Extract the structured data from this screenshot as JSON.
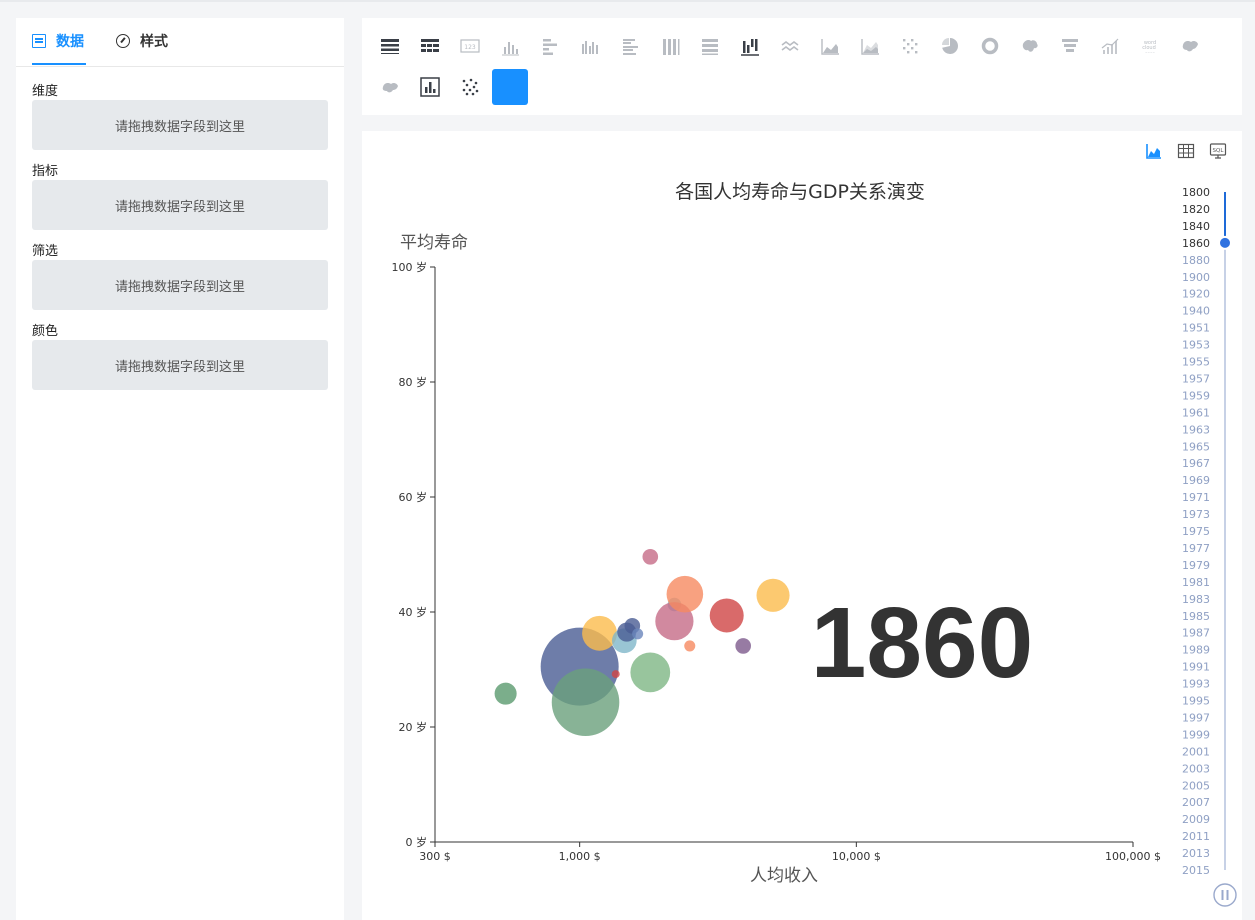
{
  "left_panel": {
    "tabs": {
      "data": "数据",
      "style": "样式"
    },
    "sections": [
      {
        "label": "维度",
        "placeholder": "请拖拽数据字段到这里"
      },
      {
        "label": "指标",
        "placeholder": "请拖拽数据字段到这里"
      },
      {
        "label": "筛选",
        "placeholder": "请拖拽数据字段到这里"
      },
      {
        "label": "颜色",
        "placeholder": "请拖拽数据字段到这里"
      }
    ]
  },
  "toolbar": {
    "chart_types": [
      "table-icon",
      "pivot-table-icon",
      "kpi-number-icon",
      "column-chart-icon",
      "bar-chart-icon",
      "grouped-column-icon",
      "grouped-bar-icon",
      "stacked-column-icon",
      "stacked-bar-icon",
      "waterfall-icon",
      "line-chart-icon",
      "area-chart-icon",
      "stacked-area-icon",
      "heatmap-icon",
      "pie-chart-icon",
      "donut-chart-icon",
      "world-map-icon",
      "funnel-chart-icon",
      "combo-chart-icon",
      "word-cloud-icon",
      "china-map-icon",
      "flow-map-icon",
      "histogram-icon",
      "scatter-plot-icon",
      "bubble-animation-icon"
    ],
    "word_cloud_text": "word cloud",
    "selected": "bubble-animation-icon",
    "accent_color": "#1890ff",
    "inactive_color": "#b8bcc2"
  },
  "chart_header": {
    "views": [
      "chart-view-icon",
      "table-view-icon",
      "sql-view-icon"
    ],
    "sql_text": "SQL"
  },
  "chart_data": {
    "type": "scatter",
    "title": "各国人均寿命与GDP关系演变",
    "xlabel": "人均收入",
    "ylabel": "平均寿命",
    "x_scale": "log",
    "xlim": [
      300,
      100000
    ],
    "ylim": [
      0,
      100
    ],
    "x_ticks": [
      "300 $",
      "1,000 $",
      "10,000 $",
      "100,000 $"
    ],
    "x_tick_values": [
      300,
      1000,
      10000,
      100000
    ],
    "y_ticks": [
      "0 岁",
      "20 岁",
      "40 岁",
      "60 岁",
      "80 岁",
      "100 岁"
    ],
    "y_tick_values": [
      0,
      20,
      40,
      60,
      80,
      100
    ],
    "current_year": "1860",
    "grid": false,
    "points": [
      {
        "x": 540,
        "y": 25.8,
        "size": 0.08,
        "color": "#5a9a6e"
      },
      {
        "x": 1000,
        "y": 30.5,
        "size": 1.0,
        "color": "#4a5d94"
      },
      {
        "x": 1050,
        "y": 24.3,
        "size": 0.75,
        "color": "#6aa07c"
      },
      {
        "x": 1180,
        "y": 36.3,
        "size": 0.2,
        "color": "#fbbc4c"
      },
      {
        "x": 1350,
        "y": 29.2,
        "size": 0.01,
        "color": "#d04545"
      },
      {
        "x": 1450,
        "y": 35.0,
        "size": 0.1,
        "color": "#7fb6c9"
      },
      {
        "x": 1480,
        "y": 36.5,
        "size": 0.06,
        "color": "#4a5d94"
      },
      {
        "x": 1550,
        "y": 37.6,
        "size": 0.04,
        "color": "#4a5d94"
      },
      {
        "x": 1620,
        "y": 36.2,
        "size": 0.02,
        "color": "#6a86bb"
      },
      {
        "x": 1800,
        "y": 29.5,
        "size": 0.26,
        "color": "#7eb785"
      },
      {
        "x": 1800,
        "y": 49.6,
        "size": 0.04,
        "color": "#c56b87"
      },
      {
        "x": 2200,
        "y": 41.3,
        "size": 0.03,
        "color": "#7fb6c9"
      },
      {
        "x": 2200,
        "y": 38.4,
        "size": 0.24,
        "color": "#c56b87"
      },
      {
        "x": 2500,
        "y": 34.1,
        "size": 0.02,
        "color": "#f68960"
      },
      {
        "x": 2400,
        "y": 43.1,
        "size": 0.22,
        "color": "#f68960"
      },
      {
        "x": 3400,
        "y": 39.4,
        "size": 0.19,
        "color": "#d04545"
      },
      {
        "x": 3900,
        "y": 34.1,
        "size": 0.04,
        "color": "#7d5a8c"
      },
      {
        "x": 5000,
        "y": 42.9,
        "size": 0.18,
        "color": "#fbbc4c"
      }
    ]
  },
  "timeline": {
    "years": [
      "1800",
      "1820",
      "1840",
      "1860",
      "1880",
      "1900",
      "1920",
      "1940",
      "1951",
      "1953",
      "1955",
      "1957",
      "1959",
      "1961",
      "1963",
      "1965",
      "1967",
      "1969",
      "1971",
      "1973",
      "1975",
      "1977",
      "1979",
      "1981",
      "1983",
      "1985",
      "1987",
      "1989",
      "1991",
      "1993",
      "1995",
      "1997",
      "1999",
      "2001",
      "2003",
      "2005",
      "2007",
      "2009",
      "2011",
      "2013",
      "2015"
    ],
    "current": "1860",
    "play_state": "paused"
  }
}
